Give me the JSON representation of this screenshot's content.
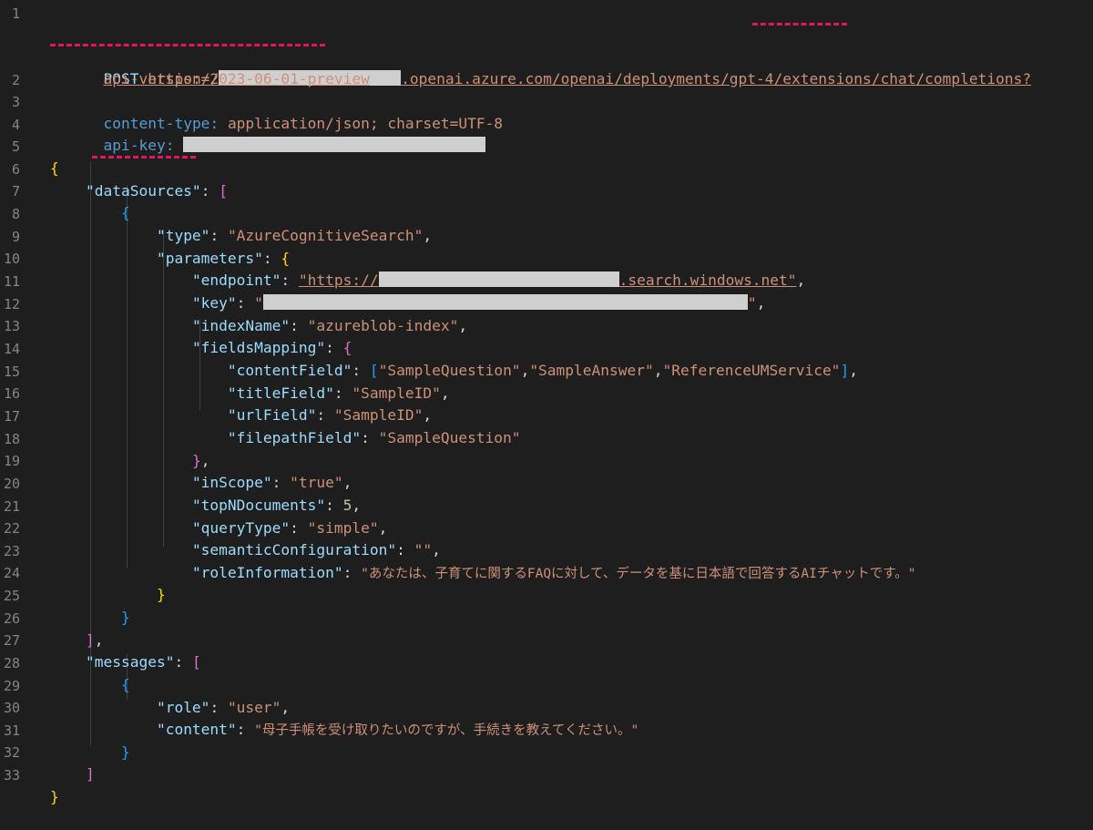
{
  "request": {
    "method": "POST",
    "url_prefix": "https://",
    "url_suffix": ".openai.azure.com/openai/deployments/gpt-4/extensions/chat/completions?",
    "query": "api-version=2023-06-01-preview",
    "headers": [
      {
        "name": "content-type:",
        "value": "application/json; charset=UTF-8"
      },
      {
        "name": "api-key:",
        "value": ""
      }
    ]
  },
  "line_numbers": [
    "1",
    "2",
    "3",
    "4",
    "5",
    "6",
    "7",
    "8",
    "9",
    "10",
    "11",
    "12",
    "13",
    "14",
    "15",
    "16",
    "17",
    "18",
    "19",
    "20",
    "21",
    "22",
    "23",
    "24",
    "25",
    "26",
    "27",
    "28",
    "29",
    "30",
    "31",
    "32",
    "33"
  ],
  "body": {
    "keys": {
      "dataSources": "\"dataSources\"",
      "type": "\"type\"",
      "parameters": "\"parameters\"",
      "endpoint": "\"endpoint\"",
      "key": "\"key\"",
      "indexName": "\"indexName\"",
      "fieldsMapping": "\"fieldsMapping\"",
      "contentField": "\"contentField\"",
      "titleField": "\"titleField\"",
      "urlField": "\"urlField\"",
      "filepathField": "\"filepathField\"",
      "inScope": "\"inScope\"",
      "topNDocuments": "\"topNDocuments\"",
      "queryType": "\"queryType\"",
      "semanticConfiguration": "\"semanticConfiguration\"",
      "roleInformation": "\"roleInformation\"",
      "messages": "\"messages\"",
      "role": "\"role\"",
      "content": "\"content\""
    },
    "values": {
      "type": "\"AzureCognitiveSearch\"",
      "endpoint_prefix": "\"https://",
      "endpoint_suffix": ".search.windows.net\"",
      "key_open": "\"",
      "key_close": "\"",
      "indexName": "\"azureblob-index\"",
      "contentField_1": "\"SampleQuestion\"",
      "contentField_2": "\"SampleAnswer\"",
      "contentField_3": "\"ReferenceUMService\"",
      "titleField": "\"SampleID\"",
      "urlField": "\"SampleID\"",
      "filepathField": "\"SampleQuestion\"",
      "inScope": "\"true\"",
      "topNDocuments": "5",
      "queryType": "\"simple\"",
      "semanticConfiguration": "\"\"",
      "roleInformation": "\"あなたは、子育てに関するFAQに対して、データを基に日本語で回答するAIチャットです。\"",
      "role": "\"user\"",
      "content": "\"母子手帳を受け取りたいのですが、手続きを教えてください。\""
    }
  },
  "colors": {
    "background": "#1e1e1e",
    "key": "#9cdcfe",
    "string": "#ce9178",
    "number": "#b5cea8",
    "brace_level1": "#ffd700",
    "brace_level2": "#da70d6",
    "brace_level3": "#179fff",
    "squiggle": "#e0165f",
    "line_number": "#858585"
  }
}
